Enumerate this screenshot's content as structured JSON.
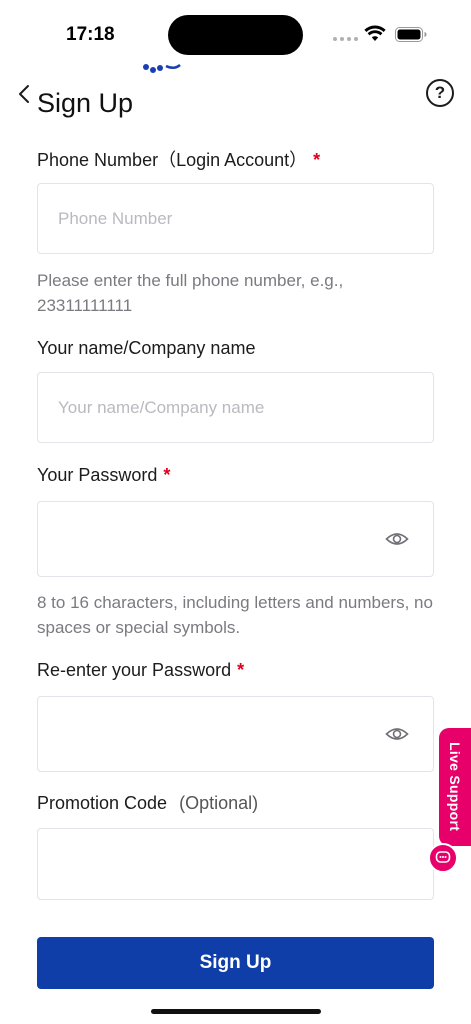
{
  "status_bar": {
    "time": "17:18"
  },
  "header": {
    "title": "Sign Up",
    "back_icon": "chevron-left-icon",
    "help_icon": "question-circle-icon",
    "help_glyph": "?"
  },
  "form": {
    "phone": {
      "label": "Phone Number（Login Account）",
      "required_mark": "*",
      "placeholder": "Phone Number",
      "value": "",
      "hint": "Please enter the full phone number, e.g., 23311111111"
    },
    "name": {
      "label": "Your name/Company name",
      "placeholder": "Your name/Company name",
      "value": ""
    },
    "password": {
      "label": "Your Password",
      "required_mark": "*",
      "value": "",
      "hint": "8 to 16 characters, including letters and numbers, no spaces or special symbols.",
      "toggle_icon": "eye-icon"
    },
    "confirm_password": {
      "label": "Re-enter your Password",
      "required_mark": "*",
      "value": "",
      "toggle_icon": "eye-icon"
    },
    "promotion_code": {
      "label": "Promotion Code",
      "optional_label": "(Optional)",
      "value": ""
    },
    "submit_label": "Sign Up"
  },
  "live_support": {
    "label": "Live Support",
    "icon": "chat-bubble-icon"
  },
  "colors": {
    "primary": "#0f3ea8",
    "required": "#e0001b",
    "live_support": "#e8006a",
    "hint": "#7a7a80",
    "input_border": "#e3e3ea"
  }
}
